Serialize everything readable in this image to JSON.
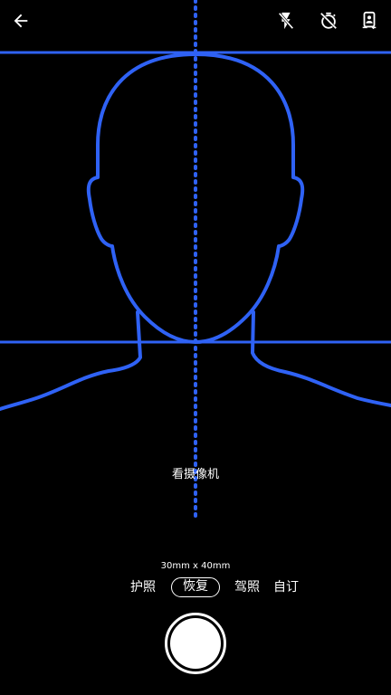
{
  "toolbar": {
    "back_icon": "arrow-left-icon",
    "flash_icon": "flash-off-icon",
    "timer_icon": "timer-off-icon",
    "switch_icon": "switch-camera-icon"
  },
  "guide": {
    "color": "#2f62f5"
  },
  "hint": "看摄像机",
  "size_label": "30mm x 40mm",
  "modes": [
    {
      "label": "护照",
      "selected": false
    },
    {
      "label": "恢复",
      "selected": true
    },
    {
      "label": "驾照",
      "selected": false
    },
    {
      "label": "自订",
      "selected": false
    }
  ]
}
